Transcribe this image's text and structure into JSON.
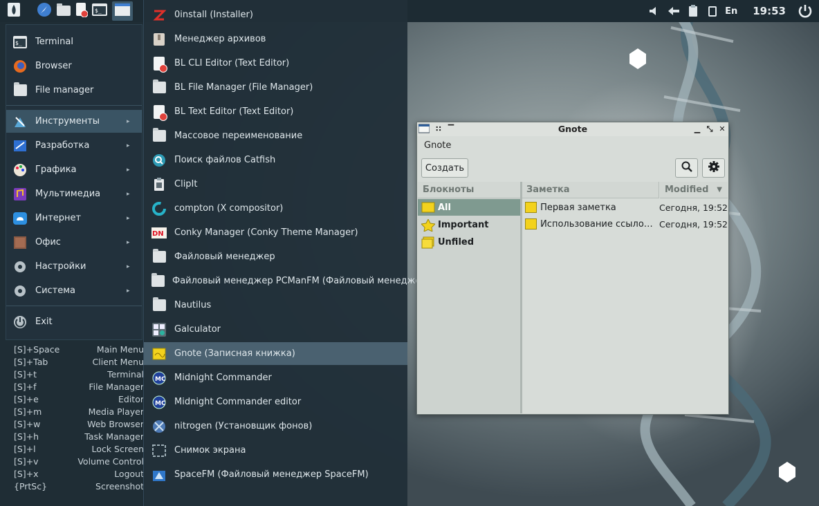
{
  "panel": {
    "launchers": [
      "app-menu-icon",
      "browser-icon",
      "file-manager-icon",
      "text-editor-icon",
      "terminal-icon",
      "window-icon"
    ],
    "tray": {
      "language": "En",
      "clock": "19:53"
    }
  },
  "conky": {
    "shortcuts": [
      {
        "key": "[S]+Space",
        "action": "Main Menu"
      },
      {
        "key": "[S]+Tab",
        "action": "Client Menu"
      },
      {
        "key": "[S]+t",
        "action": "Terminal"
      },
      {
        "key": "[S]+f",
        "action": "File Manager"
      },
      {
        "key": "[S]+e",
        "action": "Editor"
      },
      {
        "key": "[S]+m",
        "action": "Media Player"
      },
      {
        "key": "[S]+w",
        "action": "Web Browser"
      },
      {
        "key": "[S]+h",
        "action": "Task Manager"
      },
      {
        "key": "[S]+l",
        "action": "Lock Screen"
      },
      {
        "key": "[S]+v",
        "action": "Volume Control"
      },
      {
        "key": "[S]+x",
        "action": "Logout"
      },
      {
        "key": "{PrtSc}",
        "action": "Screenshot"
      }
    ]
  },
  "main_menu": {
    "items": [
      {
        "label": "Terminal",
        "icon": "terminal-icon"
      },
      {
        "label": "Browser",
        "icon": "firefox-icon"
      },
      {
        "label": "File manager",
        "icon": "folder-icon"
      },
      {
        "label": "Инструменты",
        "icon": "tools-icon",
        "submenu": true,
        "selected": true
      },
      {
        "label": "Разработка",
        "icon": "development-icon",
        "submenu": true
      },
      {
        "label": "Графика",
        "icon": "graphics-icon",
        "submenu": true
      },
      {
        "label": "Мультимедиа",
        "icon": "multimedia-icon",
        "submenu": true
      },
      {
        "label": "Интернет",
        "icon": "internet-icon",
        "submenu": true
      },
      {
        "label": "Офис",
        "icon": "office-icon",
        "submenu": true
      },
      {
        "label": "Настройки",
        "icon": "settings-icon",
        "submenu": true
      },
      {
        "label": "Система",
        "icon": "system-icon",
        "submenu": true
      },
      {
        "label": "Exit",
        "icon": "power-icon"
      }
    ],
    "arrow": "▸"
  },
  "submenu": {
    "items": [
      {
        "label": "0install (Installer)",
        "icon": "zeroinstall-icon"
      },
      {
        "label": "Менеджер архивов",
        "icon": "archive-icon"
      },
      {
        "label": "BL CLI Editor (Text Editor)",
        "icon": "text-editor-icon"
      },
      {
        "label": "BL File Manager (File Manager)",
        "icon": "folder-icon"
      },
      {
        "label": "BL Text Editor (Text Editor)",
        "icon": "text-editor-icon"
      },
      {
        "label": "Массовое переименование",
        "icon": "folder-icon"
      },
      {
        "label": "Поиск файлов Catfish",
        "icon": "catfish-search-icon"
      },
      {
        "label": "ClipIt",
        "icon": "clipboard-icon"
      },
      {
        "label": "compton (X compositor)",
        "icon": "compton-icon"
      },
      {
        "label": "Conky Manager (Conky Theme Manager)",
        "icon": "conky-icon"
      },
      {
        "label": "Файловый менеджер",
        "icon": "folder-icon"
      },
      {
        "label": "Файловый менеджер PCManFM (Файловый менеджер)",
        "icon": "folder-icon"
      },
      {
        "label": "Nautilus",
        "icon": "folder-icon"
      },
      {
        "label": "Galculator",
        "icon": "calculator-icon"
      },
      {
        "label": "Gnote (Записная книжка)",
        "icon": "gnote-icon",
        "selected": true
      },
      {
        "label": "Midnight Commander",
        "icon": "mc-icon"
      },
      {
        "label": "Midnight Commander editor",
        "icon": "mc-icon"
      },
      {
        "label": "nitrogen (Установщик фонов)",
        "icon": "nitrogen-icon"
      },
      {
        "label": "Снимок экрана",
        "icon": "screenshot-icon"
      },
      {
        "label": "SpaceFM (Файловый менеджер SpaceFM)",
        "icon": "spacefm-icon"
      }
    ]
  },
  "gnote": {
    "window_title": "Gnote",
    "app_title": "Gnote",
    "create_label": "Создать",
    "notebooks_header": "Блокноты",
    "note_header": "Заметка",
    "modified_header": "Modified",
    "notebooks": [
      {
        "label": "All",
        "selected": true
      },
      {
        "label": "Important"
      },
      {
        "label": "Unfiled"
      }
    ],
    "notes": [
      {
        "title": "Первая заметка",
        "modified": "Сегодня, 19:52"
      },
      {
        "title": "Использование ссылок в Gnote",
        "modified": "Сегодня, 19:52"
      }
    ]
  }
}
